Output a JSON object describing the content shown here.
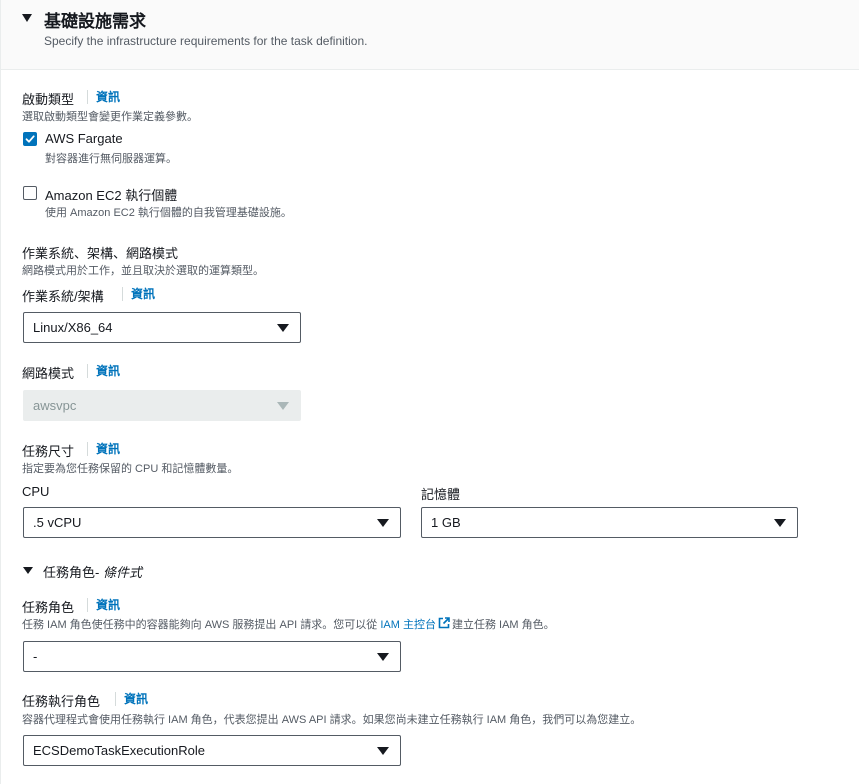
{
  "header": {
    "title": "基礎設施需求",
    "description": "Specify the infrastructure requirements for the task definition."
  },
  "launch_type": {
    "label": "啟動類型",
    "info": "資訊",
    "description": "選取啟動類型會變更作業定義參數。",
    "options": [
      {
        "label": "AWS Fargate",
        "description": "對容器進行無伺服器運算。",
        "checked": true
      },
      {
        "label": "Amazon EC2 執行個體",
        "description": "使用 Amazon EC2 執行個體的自我管理基礎設施。",
        "checked": false
      }
    ]
  },
  "os_arch_network": {
    "title": "作業系統、架構、網路模式",
    "description": "網路模式用於工作，並且取決於選取的運算類型。",
    "os_label": "作業系統/架構",
    "os_info": "資訊",
    "os_value": "Linux/X86_64",
    "network_label": "網路模式",
    "network_info": "資訊",
    "network_value": "awsvpc"
  },
  "task_size": {
    "label": "任務尺寸",
    "info": "資訊",
    "description": "指定要為您任務保留的 CPU 和記憶體數量。",
    "cpu_label": "CPU",
    "cpu_value": ".5 vCPU",
    "memory_label": "記憶體",
    "memory_value": "1 GB"
  },
  "task_role_section": {
    "title": "任務角色-",
    "optional": "條件式"
  },
  "task_role": {
    "label": "任務角色",
    "info": "資訊",
    "description_pre": "任務 IAM 角色使任務中的容器能夠向 AWS 服務提出 API 請求。您可以從",
    "console_link": "IAM 主控台",
    "description_post": "建立任務 IAM 角色。",
    "value": "-"
  },
  "execution_role": {
    "label": "任務執行角色",
    "info": "資訊",
    "description": "容器代理程式會使用任務執行 IAM 角色，代表您提出 AWS API 請求。如果您尚未建立任務執行 IAM 角色，我們可以為您建立。",
    "value": "ECSDemoTaskExecutionRole"
  },
  "icons": {
    "collapse": "caret-down-icon",
    "check": "checkmark-icon",
    "external_link": "external-link-icon",
    "dropdown": "dropdown-caret-icon"
  },
  "colors": {
    "link": "#0073bb",
    "checked": "#0073bb",
    "text": "#16191f",
    "muted": "#545b64",
    "disabled_bg": "#eaeded"
  }
}
